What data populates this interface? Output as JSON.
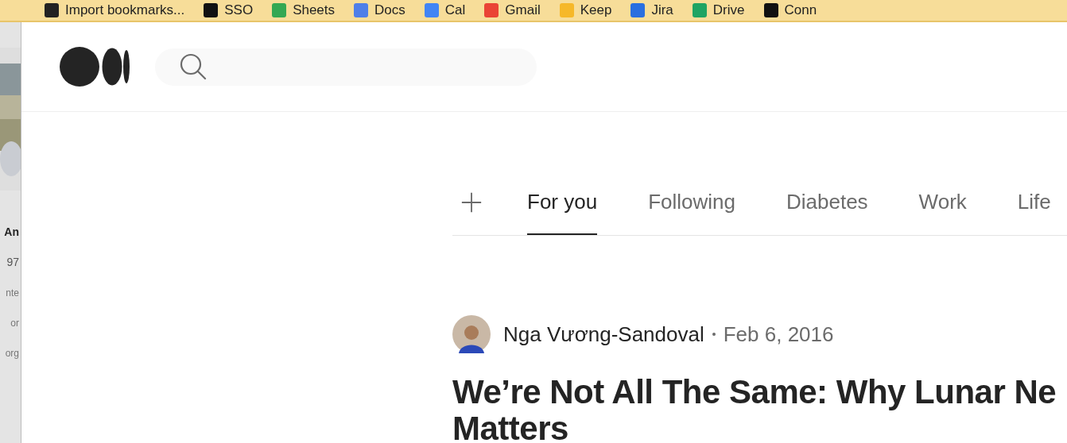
{
  "bookmarks": [
    {
      "label": "Import bookmarks..."
    },
    {
      "label": "SSO"
    },
    {
      "label": "Sheets"
    },
    {
      "label": "Docs"
    },
    {
      "label": "Cal"
    },
    {
      "label": "Gmail"
    },
    {
      "label": "Keep"
    },
    {
      "label": "Jira"
    },
    {
      "label": "Drive"
    },
    {
      "label": "Conn"
    }
  ],
  "side_panel": {
    "name": "An",
    "count": "97",
    "lines": [
      "nte",
      "or",
      "org"
    ]
  },
  "tabs": [
    {
      "label": "For you",
      "selected": true
    },
    {
      "label": "Following",
      "selected": false
    },
    {
      "label": "Diabetes",
      "selected": false
    },
    {
      "label": "Work",
      "selected": false
    },
    {
      "label": "Life",
      "selected": false
    }
  ],
  "post": {
    "author": "Nga Vương-Sandoval",
    "date": "Feb 6, 2016",
    "title_lines": [
      "We’re Not All The Same: Why Lunar Ne",
      "Matters"
    ]
  }
}
